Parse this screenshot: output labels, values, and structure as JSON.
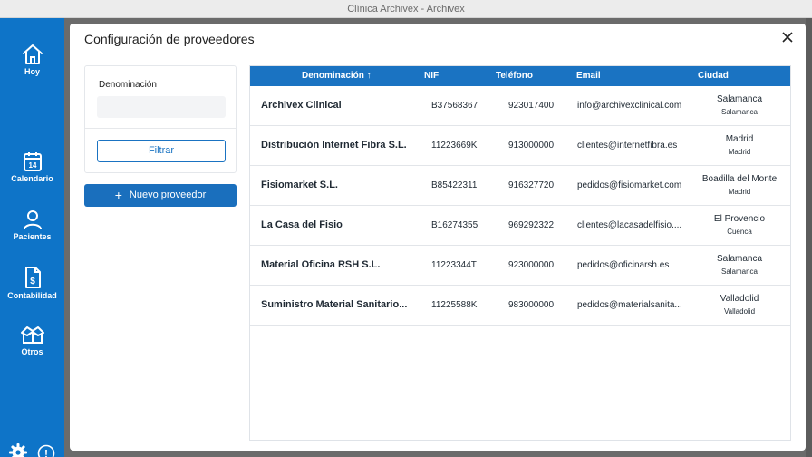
{
  "window": {
    "title": "Clínica Archivex - Archivex"
  },
  "sidebar": {
    "items": [
      {
        "label": "Hoy",
        "icon": "home-icon"
      },
      {
        "label": "Calendario",
        "icon": "calendar-icon",
        "badge": "14"
      },
      {
        "label": "Pacientes",
        "icon": "person-icon"
      },
      {
        "label": "Contabilidad",
        "icon": "invoice-icon"
      },
      {
        "label": "Otros",
        "icon": "box-icon"
      }
    ],
    "bottom": {
      "settings_icon": "gear-icon",
      "info_icon": "info-icon",
      "info_glyph": "!"
    }
  },
  "modal": {
    "title": "Configuración de proveedores",
    "close_icon": "close-icon",
    "filter": {
      "label": "Denominación",
      "input_value": "",
      "button_label": "Filtrar"
    },
    "new_button": {
      "label": "Nuevo proveedor",
      "icon": "plus-icon"
    },
    "table": {
      "headers": {
        "name": "Denominación ↑",
        "nif": "NIF",
        "phone": "Teléfono",
        "email": "Email",
        "city": "Ciudad"
      },
      "rows": [
        {
          "name": "Archivex Clinical",
          "nif": "B37568367",
          "phone": "923017400",
          "email": "info@archivexclinical.com",
          "city": "Salamanca",
          "province": "Salamanca"
        },
        {
          "name": "Distribución Internet Fibra S.L.",
          "nif": "11223669K",
          "phone": "913000000",
          "email": "clientes@internetfibra.es",
          "city": "Madrid",
          "province": "Madrid"
        },
        {
          "name": "Fisiomarket S.L.",
          "nif": "B85422311",
          "phone": "916327720",
          "email": "pedidos@fisiomarket.com",
          "city": "Boadilla del Monte",
          "province": "Madrid"
        },
        {
          "name": "La Casa del Fisio",
          "nif": "B16274355",
          "phone": "969292322",
          "email": "clientes@lacasadelfisio....",
          "city": "El Provencio",
          "province": "Cuenca"
        },
        {
          "name": "Material Oficina RSH S.L.",
          "nif": "11223344T",
          "phone": "923000000",
          "email": "pedidos@oficinarsh.es",
          "city": "Salamanca",
          "province": "Salamanca"
        },
        {
          "name": "Suministro Material Sanitario...",
          "nif": "11225588K",
          "phone": "983000000",
          "email": "pedidos@materialsanita...",
          "city": "Valladolid",
          "province": "Valladolid"
        }
      ]
    }
  },
  "colors": {
    "accent": "#0e74c8",
    "header": "#1a73c2",
    "button": "#1a6fbd"
  }
}
